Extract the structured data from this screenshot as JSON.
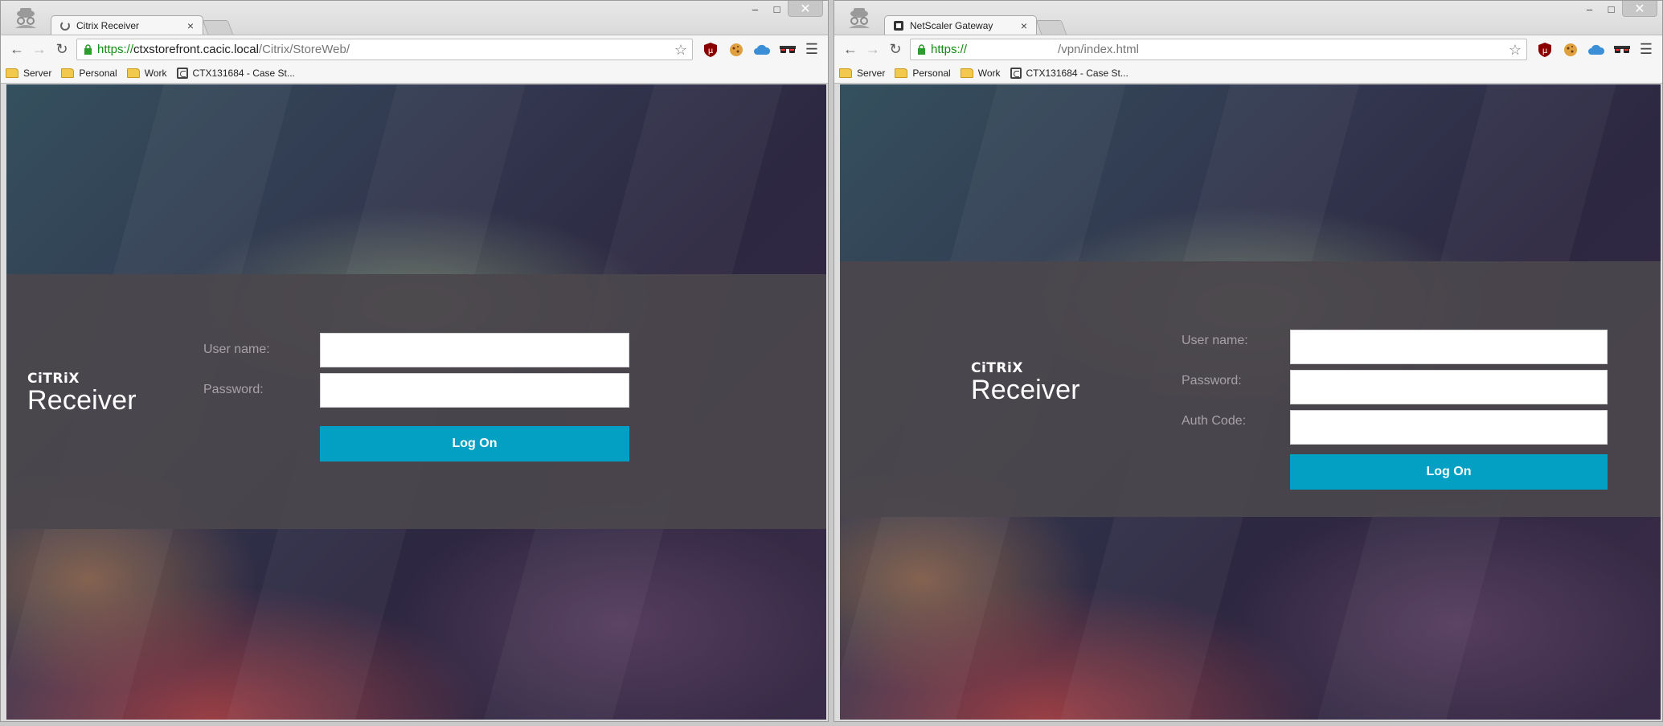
{
  "left_window": {
    "tab": {
      "title": "Citrix Receiver",
      "close": "×"
    },
    "address": {
      "scheme": "https://",
      "host": "ctxstorefront.cacic.local",
      "path": "/Citrix/StoreWeb/"
    },
    "bookmarks": [
      "Server",
      "Personal",
      "Work",
      "CTX131684 - Case St..."
    ],
    "brand": {
      "small": "CiTRiX",
      "large": "Receiver"
    },
    "form": {
      "username_label": "User name:",
      "password_label": "Password:",
      "logon_label": "Log On"
    }
  },
  "right_window": {
    "tab": {
      "title": "NetScaler Gateway",
      "close": "×"
    },
    "address": {
      "scheme": "https://",
      "host": "",
      "path": "/vpn/index.html"
    },
    "bookmarks": [
      "Server",
      "Personal",
      "Work",
      "CTX131684 - Case St..."
    ],
    "brand": {
      "small": "CiTRiX",
      "large": "Receiver"
    },
    "form": {
      "username_label": "User name:",
      "password_label": "Password:",
      "authcode_label": "Auth Code:",
      "logon_label": "Log On"
    }
  },
  "window_controls": {
    "minimize": "–",
    "maximize": "□",
    "close": "✕"
  },
  "colors": {
    "logon_button": "#03a0c4",
    "panel": "#4b464c",
    "url_scheme": "#128b12"
  }
}
